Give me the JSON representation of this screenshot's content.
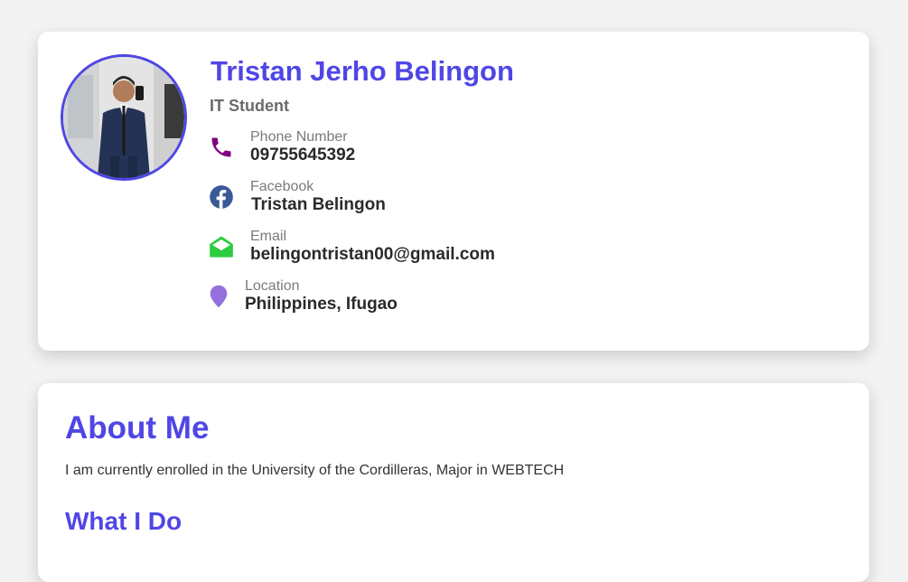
{
  "profile": {
    "name": "Tristan Jerho Belingon",
    "role": "IT Student",
    "contacts": [
      {
        "label": "Phone Number",
        "value": "09755645392",
        "icon": "phone-icon",
        "color": "#800080"
      },
      {
        "label": "Facebook",
        "value": "Tristan Belingon",
        "icon": "facebook-icon",
        "color": "#3b5998"
      },
      {
        "label": "Email",
        "value": "belingontristan00@gmail.com",
        "icon": "envelope-icon",
        "color": "#2ecc40"
      },
      {
        "label": "Location",
        "value": "Philippines, Ifugao",
        "icon": "location-pin-icon",
        "color": "#9370db"
      }
    ]
  },
  "about": {
    "title": "About Me",
    "text": "I am currently enrolled in the University of the Cordilleras, Major in WEBTECH",
    "what_i_do_title": "What I Do"
  },
  "theme": {
    "accent": "#4f46e5",
    "background": "#f3f3f3"
  }
}
